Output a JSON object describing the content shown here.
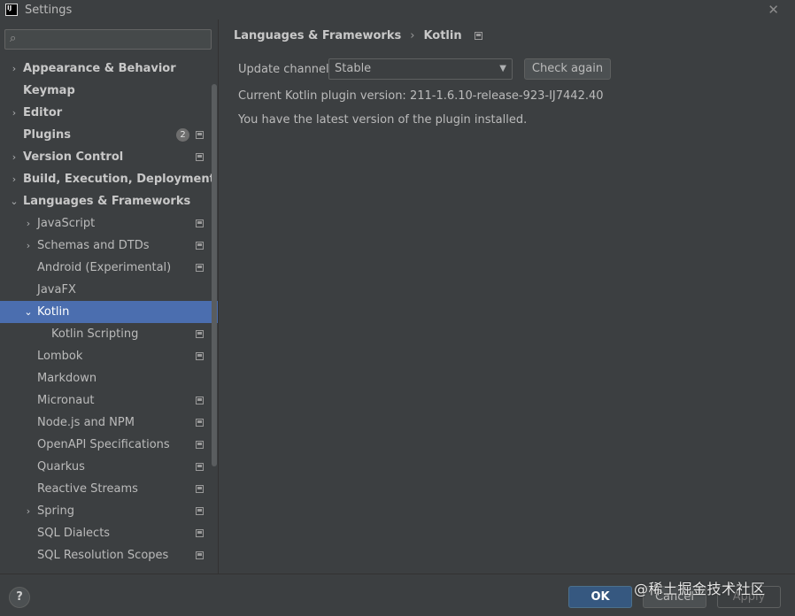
{
  "window": {
    "logo_text": "IJ",
    "title": "Settings",
    "close_glyph": "✕"
  },
  "search": {
    "placeholder": "",
    "value": ""
  },
  "sidebar": {
    "items": [
      {
        "label": "Appearance & Behavior",
        "level": 0,
        "chevron": "›",
        "bold": true
      },
      {
        "label": "Keymap",
        "level": 0,
        "bold": true
      },
      {
        "label": "Editor",
        "level": 0,
        "chevron": "›",
        "bold": true
      },
      {
        "label": "Plugins",
        "level": 0,
        "bold": true,
        "badge": "2",
        "project_icon": true
      },
      {
        "label": "Version Control",
        "level": 0,
        "chevron": "›",
        "bold": true,
        "project_icon": true
      },
      {
        "label": "Build, Execution, Deployment",
        "level": 0,
        "chevron": "›",
        "bold": true
      },
      {
        "label": "Languages & Frameworks",
        "level": 0,
        "chevron": "⌄",
        "bold": true
      },
      {
        "label": "JavaScript",
        "level": 1,
        "chevron": "›",
        "project_icon": true
      },
      {
        "label": "Schemas and DTDs",
        "level": 1,
        "chevron": "›",
        "project_icon": true
      },
      {
        "label": "Android (Experimental)",
        "level": 1,
        "project_icon": true
      },
      {
        "label": "JavaFX",
        "level": 1
      },
      {
        "label": "Kotlin",
        "level": 1,
        "chevron": "⌄",
        "selected": true
      },
      {
        "label": "Kotlin Scripting",
        "level": 2,
        "project_icon": true
      },
      {
        "label": "Lombok",
        "level": 1,
        "project_icon": true
      },
      {
        "label": "Markdown",
        "level": 1
      },
      {
        "label": "Micronaut",
        "level": 1,
        "project_icon": true
      },
      {
        "label": "Node.js and NPM",
        "level": 1,
        "project_icon": true
      },
      {
        "label": "OpenAPI Specifications",
        "level": 1,
        "project_icon": true
      },
      {
        "label": "Quarkus",
        "level": 1,
        "project_icon": true
      },
      {
        "label": "Reactive Streams",
        "level": 1,
        "project_icon": true
      },
      {
        "label": "Spring",
        "level": 1,
        "chevron": "›",
        "project_icon": true
      },
      {
        "label": "SQL Dialects",
        "level": 1,
        "project_icon": true
      },
      {
        "label": "SQL Resolution Scopes",
        "level": 1,
        "project_icon": true
      }
    ]
  },
  "breadcrumb": {
    "parent": "Languages & Frameworks",
    "separator": "›",
    "current": "Kotlin"
  },
  "kotlin": {
    "channel_label": "Update channel:",
    "channel_value": "Stable",
    "check_again_label": "Check again",
    "version_text": "Current Kotlin plugin version:  211-1.6.10-release-923-IJ7442.40",
    "status_text": "You have the latest version of the plugin installed."
  },
  "footer": {
    "help_label": "?",
    "ok_label": "OK",
    "cancel_label": "Cancel",
    "apply_label": "Apply",
    "watermark": "@稀土掘金技术社区"
  },
  "colors": {
    "background": "#3c3f41",
    "selection": "#4b6eaf",
    "ok_button": "#365880",
    "text": "#bbbbbb"
  }
}
